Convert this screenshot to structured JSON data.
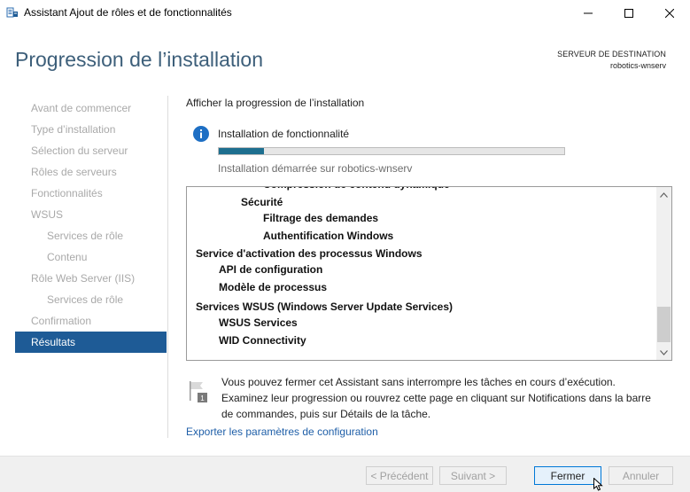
{
  "window": {
    "title": "Assistant Ajout de rôles et de fonctionnalités"
  },
  "header": {
    "page_title": "Progression de l’installation",
    "destination_label": "SERVEUR DE DESTINATION",
    "destination_server": "robotics-wnserv"
  },
  "nav": {
    "items": [
      {
        "label": "Avant de commencer",
        "level": 0,
        "active": false
      },
      {
        "label": "Type d’installation",
        "level": 0,
        "active": false
      },
      {
        "label": "Sélection du serveur",
        "level": 0,
        "active": false
      },
      {
        "label": "Rôles de serveurs",
        "level": 0,
        "active": false
      },
      {
        "label": "Fonctionnalités",
        "level": 0,
        "active": false
      },
      {
        "label": "WSUS",
        "level": 0,
        "active": false
      },
      {
        "label": "Services de rôle",
        "level": 1,
        "active": false
      },
      {
        "label": "Contenu",
        "level": 1,
        "active": false
      },
      {
        "label": "Rôle Web Server (IIS)",
        "level": 0,
        "active": false
      },
      {
        "label": "Services de rôle",
        "level": 1,
        "active": false
      },
      {
        "label": "Confirmation",
        "level": 0,
        "active": false
      },
      {
        "label": "Résultats",
        "level": 0,
        "active": true
      }
    ]
  },
  "main": {
    "section_title": "Afficher la progression de l’installation",
    "install_title": "Installation de fonctionnalité",
    "progress_fraction": 0.13,
    "install_status": "Installation démarrée sur robotics-wnserv",
    "features": [
      {
        "label": "Compression de contenu dynamique",
        "level": 3
      },
      {
        "label": "Sécurité",
        "level": 2
      },
      {
        "label": "Filtrage des demandes",
        "level": 3
      },
      {
        "label": "Authentification Windows",
        "level": 3
      },
      {
        "label": "Service d'activation des processus Windows",
        "level": 0
      },
      {
        "label": "API de configuration",
        "level": 1
      },
      {
        "label": "Modèle de processus",
        "level": 1
      },
      {
        "label": "Services WSUS (Windows Server Update Services)",
        "level": 0
      },
      {
        "label": "WSUS Services",
        "level": 1
      },
      {
        "label": "WID Connectivity",
        "level": 1
      }
    ],
    "note": "Vous pouvez fermer cet Assistant sans interrompre les tâches en cours d’exécution. Examinez leur progression ou rouvrez cette page en cliquant sur Notifications dans la barre de commandes, puis sur Détails de la tâche.",
    "note_badge": "1",
    "export_link": "Exporter les paramètres de configuration"
  },
  "footer": {
    "previous_label": "< Précédent",
    "next_label": "Suivant >",
    "close_label": "Fermer",
    "cancel_label": "Annuler"
  },
  "colors": {
    "accent": "#1e5b96",
    "title": "#3d5f7a",
    "progress": "#1e6f8f",
    "link": "#1f5fa8"
  },
  "icons": {
    "app": "server-manager-icon",
    "info": "info-icon",
    "note": "flag-notification-icon",
    "minimize": "minimize-icon",
    "maximize": "maximize-icon",
    "close": "close-icon"
  }
}
